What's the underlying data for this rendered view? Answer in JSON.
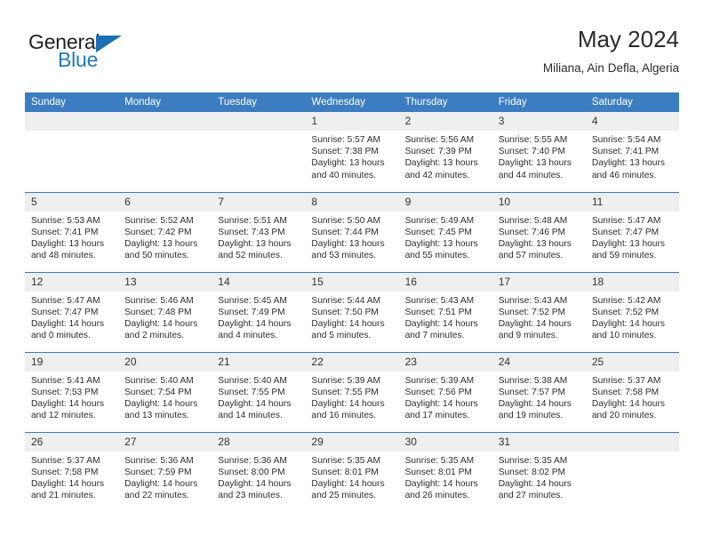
{
  "brand": {
    "name_top": "General",
    "name_bottom": "Blue",
    "triangle_color": "#1b6fb5",
    "blue_color": "#2179bd"
  },
  "header": {
    "title": "May 2024",
    "subtitle": "Miliana, Ain Defla, Algeria"
  },
  "theme": {
    "header_bg": "#3b7dc0",
    "daynum_bg": "#efefef",
    "row_rule": "#3b7dc0"
  },
  "weekdays": [
    "Sunday",
    "Monday",
    "Tuesday",
    "Wednesday",
    "Thursday",
    "Friday",
    "Saturday"
  ],
  "weeks": [
    [
      {
        "day": "",
        "lines": []
      },
      {
        "day": "",
        "lines": []
      },
      {
        "day": "",
        "lines": []
      },
      {
        "day": "1",
        "lines": [
          "Sunrise: 5:57 AM",
          "Sunset: 7:38 PM",
          "Daylight: 13 hours",
          "and 40 minutes."
        ]
      },
      {
        "day": "2",
        "lines": [
          "Sunrise: 5:56 AM",
          "Sunset: 7:39 PM",
          "Daylight: 13 hours",
          "and 42 minutes."
        ]
      },
      {
        "day": "3",
        "lines": [
          "Sunrise: 5:55 AM",
          "Sunset: 7:40 PM",
          "Daylight: 13 hours",
          "and 44 minutes."
        ]
      },
      {
        "day": "4",
        "lines": [
          "Sunrise: 5:54 AM",
          "Sunset: 7:41 PM",
          "Daylight: 13 hours",
          "and 46 minutes."
        ]
      }
    ],
    [
      {
        "day": "5",
        "lines": [
          "Sunrise: 5:53 AM",
          "Sunset: 7:41 PM",
          "Daylight: 13 hours",
          "and 48 minutes."
        ]
      },
      {
        "day": "6",
        "lines": [
          "Sunrise: 5:52 AM",
          "Sunset: 7:42 PM",
          "Daylight: 13 hours",
          "and 50 minutes."
        ]
      },
      {
        "day": "7",
        "lines": [
          "Sunrise: 5:51 AM",
          "Sunset: 7:43 PM",
          "Daylight: 13 hours",
          "and 52 minutes."
        ]
      },
      {
        "day": "8",
        "lines": [
          "Sunrise: 5:50 AM",
          "Sunset: 7:44 PM",
          "Daylight: 13 hours",
          "and 53 minutes."
        ]
      },
      {
        "day": "9",
        "lines": [
          "Sunrise: 5:49 AM",
          "Sunset: 7:45 PM",
          "Daylight: 13 hours",
          "and 55 minutes."
        ]
      },
      {
        "day": "10",
        "lines": [
          "Sunrise: 5:48 AM",
          "Sunset: 7:46 PM",
          "Daylight: 13 hours",
          "and 57 minutes."
        ]
      },
      {
        "day": "11",
        "lines": [
          "Sunrise: 5:47 AM",
          "Sunset: 7:47 PM",
          "Daylight: 13 hours",
          "and 59 minutes."
        ]
      }
    ],
    [
      {
        "day": "12",
        "lines": [
          "Sunrise: 5:47 AM",
          "Sunset: 7:47 PM",
          "Daylight: 14 hours",
          "and 0 minutes."
        ]
      },
      {
        "day": "13",
        "lines": [
          "Sunrise: 5:46 AM",
          "Sunset: 7:48 PM",
          "Daylight: 14 hours",
          "and 2 minutes."
        ]
      },
      {
        "day": "14",
        "lines": [
          "Sunrise: 5:45 AM",
          "Sunset: 7:49 PM",
          "Daylight: 14 hours",
          "and 4 minutes."
        ]
      },
      {
        "day": "15",
        "lines": [
          "Sunrise: 5:44 AM",
          "Sunset: 7:50 PM",
          "Daylight: 14 hours",
          "and 5 minutes."
        ]
      },
      {
        "day": "16",
        "lines": [
          "Sunrise: 5:43 AM",
          "Sunset: 7:51 PM",
          "Daylight: 14 hours",
          "and 7 minutes."
        ]
      },
      {
        "day": "17",
        "lines": [
          "Sunrise: 5:43 AM",
          "Sunset: 7:52 PM",
          "Daylight: 14 hours",
          "and 9 minutes."
        ]
      },
      {
        "day": "18",
        "lines": [
          "Sunrise: 5:42 AM",
          "Sunset: 7:52 PM",
          "Daylight: 14 hours",
          "and 10 minutes."
        ]
      }
    ],
    [
      {
        "day": "19",
        "lines": [
          "Sunrise: 5:41 AM",
          "Sunset: 7:53 PM",
          "Daylight: 14 hours",
          "and 12 minutes."
        ]
      },
      {
        "day": "20",
        "lines": [
          "Sunrise: 5:40 AM",
          "Sunset: 7:54 PM",
          "Daylight: 14 hours",
          "and 13 minutes."
        ]
      },
      {
        "day": "21",
        "lines": [
          "Sunrise: 5:40 AM",
          "Sunset: 7:55 PM",
          "Daylight: 14 hours",
          "and 14 minutes."
        ]
      },
      {
        "day": "22",
        "lines": [
          "Sunrise: 5:39 AM",
          "Sunset: 7:55 PM",
          "Daylight: 14 hours",
          "and 16 minutes."
        ]
      },
      {
        "day": "23",
        "lines": [
          "Sunrise: 5:39 AM",
          "Sunset: 7:56 PM",
          "Daylight: 14 hours",
          "and 17 minutes."
        ]
      },
      {
        "day": "24",
        "lines": [
          "Sunrise: 5:38 AM",
          "Sunset: 7:57 PM",
          "Daylight: 14 hours",
          "and 19 minutes."
        ]
      },
      {
        "day": "25",
        "lines": [
          "Sunrise: 5:37 AM",
          "Sunset: 7:58 PM",
          "Daylight: 14 hours",
          "and 20 minutes."
        ]
      }
    ],
    [
      {
        "day": "26",
        "lines": [
          "Sunrise: 5:37 AM",
          "Sunset: 7:58 PM",
          "Daylight: 14 hours",
          "and 21 minutes."
        ]
      },
      {
        "day": "27",
        "lines": [
          "Sunrise: 5:36 AM",
          "Sunset: 7:59 PM",
          "Daylight: 14 hours",
          "and 22 minutes."
        ]
      },
      {
        "day": "28",
        "lines": [
          "Sunrise: 5:36 AM",
          "Sunset: 8:00 PM",
          "Daylight: 14 hours",
          "and 23 minutes."
        ]
      },
      {
        "day": "29",
        "lines": [
          "Sunrise: 5:35 AM",
          "Sunset: 8:01 PM",
          "Daylight: 14 hours",
          "and 25 minutes."
        ]
      },
      {
        "day": "30",
        "lines": [
          "Sunrise: 5:35 AM",
          "Sunset: 8:01 PM",
          "Daylight: 14 hours",
          "and 26 minutes."
        ]
      },
      {
        "day": "31",
        "lines": [
          "Sunrise: 5:35 AM",
          "Sunset: 8:02 PM",
          "Daylight: 14 hours",
          "and 27 minutes."
        ]
      },
      {
        "day": "",
        "lines": []
      }
    ]
  ]
}
